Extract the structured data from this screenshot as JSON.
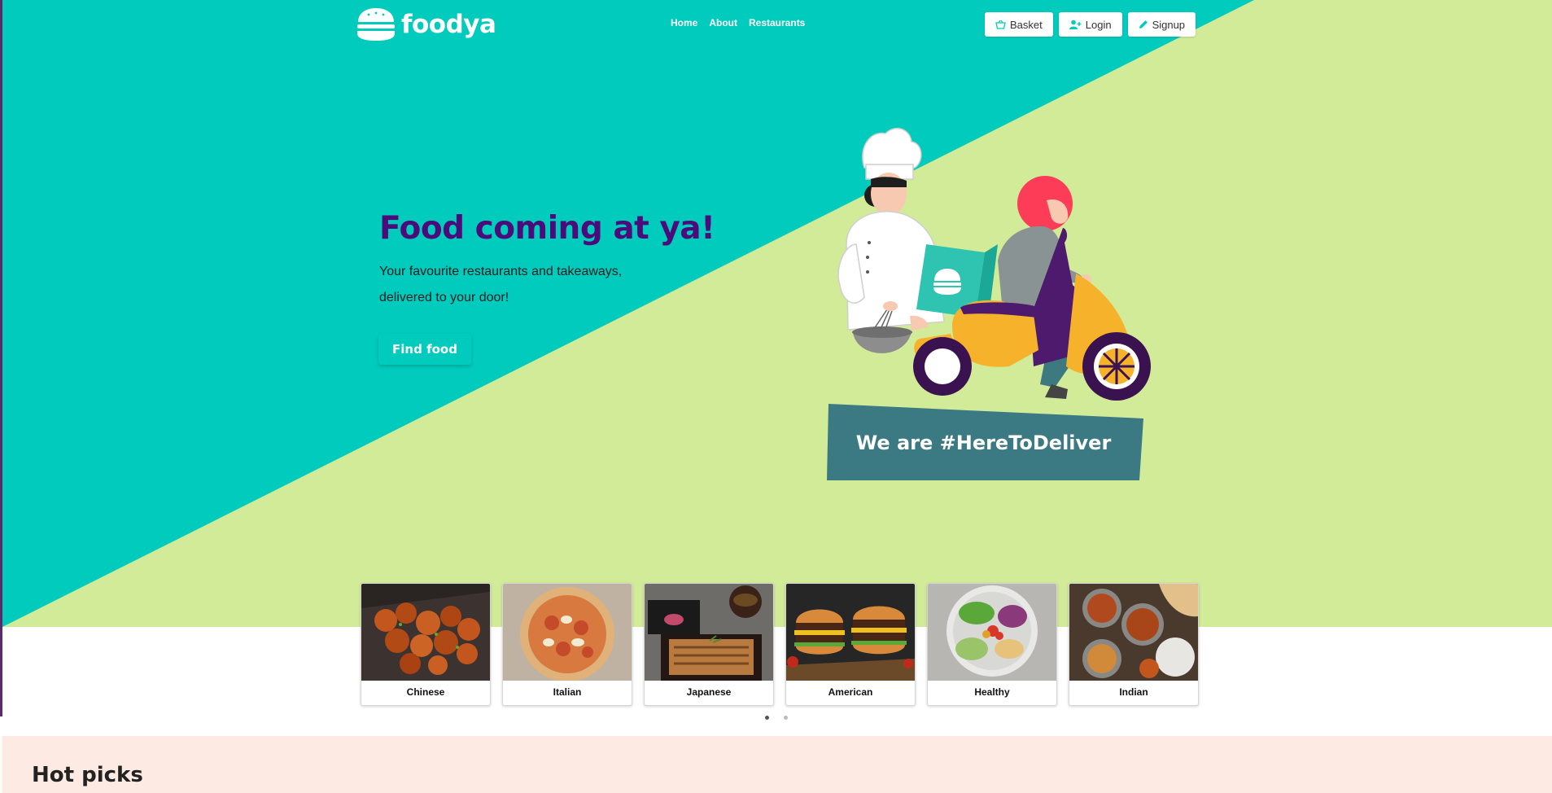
{
  "brand": {
    "name": "foodya"
  },
  "nav": {
    "links": [
      "Home",
      "About",
      "Restaurants"
    ],
    "buttons": {
      "basket": "Basket",
      "login": "Login",
      "signup": "Signup"
    }
  },
  "hero": {
    "title": "Food coming at ya!",
    "subtitle": "Your favourite restaurants and takeaways, delivered to your door!",
    "cta": "Find food",
    "banner": "We are #HereToDeliver"
  },
  "categories": [
    "Chinese",
    "Italian",
    "Japanese",
    "American",
    "Healthy",
    "Indian"
  ],
  "carousel": {
    "active_page": 1,
    "pages": 2
  },
  "hot_picks": {
    "title": "Hot picks"
  },
  "colors": {
    "teal": "#00cbbc",
    "lime": "#d1eb98",
    "purple": "#4b0b7a",
    "peach": "#fdeae2"
  }
}
